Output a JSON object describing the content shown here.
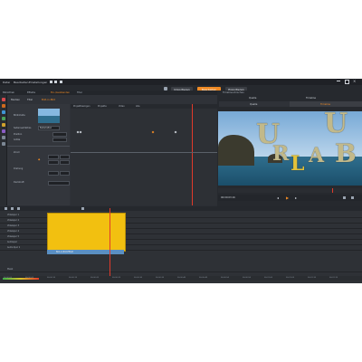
{
  "menu": {
    "items": [
      "Datei",
      "Bearbeiten",
      "Einstellungen"
    ],
    "modes": [
      {
        "label": "Importieren",
        "color": "#3a3d43"
      },
      {
        "label": "Bearbeiten",
        "color": "#f08a24"
      },
      {
        "label": "Exportieren",
        "color": "#3a3d43"
      }
    ]
  },
  "library": {
    "tabs": [
      "Bibliothek",
      "Effekte",
      "Ein-/Ausblenden",
      "Titel"
    ]
  },
  "effect_panel": {
    "subtabs": [
      "Medien",
      "Titel",
      "Bild-in-Bild"
    ],
    "prop_labels": [
      "Bildinhalte",
      "Seitenverhältnis",
      "Position",
      "Größe",
      "Zoom",
      "Drehung",
      "Deckkraft"
    ],
    "aspect_value": "Beibehalten",
    "kf_header": [
      "Projektbezogen",
      "Projekte",
      "Video",
      "Alle"
    ]
  },
  "preview": {
    "title": "Timeline-Vorschau",
    "tabs": [
      "Quelle",
      "Timeline"
    ],
    "tabs2": [
      "Quelle",
      "Timeline"
    ],
    "letters": [
      "U",
      "R",
      "L",
      "A",
      "U",
      "B"
    ],
    "timecode": "00:00:03:16"
  },
  "timeline": {
    "tracks": [
      "Videospur 1",
      "Videospur 2",
      "Videospur 3",
      "Videospur 4",
      "Videospur 5",
      "Audiospur",
      "Audio-Spur 1",
      "Musik"
    ],
    "clip_label": "Bild-in-Bild-Effekt",
    "ruler_ticks": [
      "00:00:00",
      "00:00:05",
      "00:00:10",
      "00:00:15",
      "00:00:20",
      "00:00:25",
      "00:00:30",
      "00:00:35",
      "00:00:40",
      "00:00:45",
      "00:00:50",
      "00:00:55",
      "00:01:00",
      "00:01:05",
      "00:01:10",
      "00:01:15"
    ],
    "playhead_label": "00:00:03:16"
  },
  "colors": {
    "accent": "#f08a24",
    "clip_yellow": "#f2c010",
    "clip_blue": "#5a8fc2",
    "playhead": "#e03a2a"
  }
}
